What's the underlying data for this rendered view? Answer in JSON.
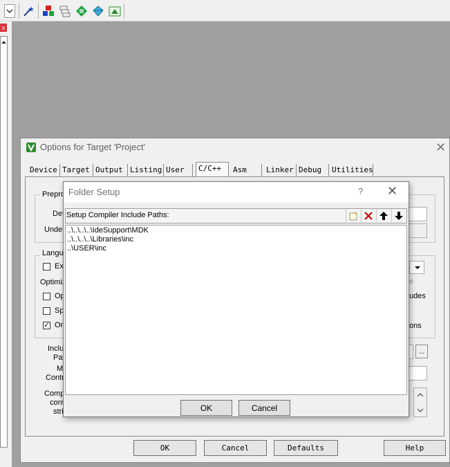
{
  "toolbar": {
    "icons": [
      "dropdown-arrow-icon",
      "magic-wand-icon",
      "manage-components-icon",
      "stack-icon",
      "pack-installer-icon",
      "diamond-icon",
      "options-icon"
    ]
  },
  "left_panel": {
    "close_label": "x"
  },
  "options_dialog": {
    "title": "Options for Target 'Project'",
    "close_label": "✕",
    "tabs": [
      {
        "label": "Device"
      },
      {
        "label": "Target"
      },
      {
        "label": "Output"
      },
      {
        "label": "Listing"
      },
      {
        "label": "User"
      },
      {
        "label": "C/C++"
      },
      {
        "label": "Asm"
      },
      {
        "label": "Linker"
      },
      {
        "label": "Debug"
      },
      {
        "label": "Utilities"
      }
    ],
    "active_tab": "C/C++",
    "preprocessor": {
      "group_label": "Prepro",
      "define_label": "Def",
      "undefine_label": "Unde"
    },
    "language": {
      "group_label": "Langu",
      "check1_label": "Ex",
      "optimization_label": "Optimiz",
      "check2_label": "Op",
      "check3_label": "Sp",
      "check4_label": "On",
      "right_text_1": "udes",
      "right_text_2": "ons",
      "dim_text": "e"
    },
    "include": {
      "include_label_1": "Inclu",
      "include_label_2": "Pat",
      "misc_label_1": "M",
      "misc_label_2": "Contr",
      "compiler_label_1": "Comp",
      "compiler_label_2": "cont",
      "compiler_label_3": "stri",
      "browse_label": "..."
    },
    "buttons": {
      "ok": "OK",
      "cancel": "Cancel",
      "defaults": "Defaults",
      "help": "Help"
    }
  },
  "folder_dialog": {
    "title": "Folder Setup",
    "help_label": "?",
    "close_label": "✕",
    "header": "Setup Compiler Include Paths:",
    "paths": [
      "..\\..\\..\\..\\IdeSupport\\MDK",
      "..\\..\\..\\..\\Libraries\\inc",
      "..\\USER\\inc"
    ],
    "buttons": {
      "ok": "OK",
      "cancel": "Cancel"
    }
  },
  "colors": {
    "workspace": "#a0a0a0",
    "dialog_bg": "#f0f0f0",
    "delete_red": "#d00000",
    "keil_green": "#2e8b2e"
  }
}
